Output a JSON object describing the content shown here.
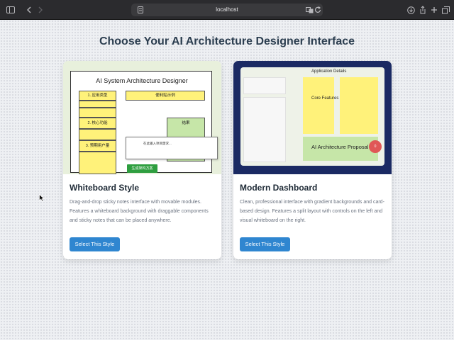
{
  "browser": {
    "url": "localhost"
  },
  "page": {
    "title": "Choose Your AI Architecture Designer Interface"
  },
  "cards": [
    {
      "title": "Whiteboard Style",
      "description": "Drag-and-drop sticky notes interface with movable modules. Features a whiteboard background with draggable components and sticky notes that can be placed anywhere.",
      "button": "Select This Style",
      "preview": {
        "heading": "AI System Architecture Designer",
        "stickies": [
          "1. 应用类型",
          "2. 核心功能",
          "3. 预期用户量"
        ],
        "example_note": "便利贴示例",
        "result_note": "结果",
        "input_placeholder": "在此输入项目需求...",
        "generate_button": "生成架构方案"
      }
    },
    {
      "title": "Modern Dashboard",
      "description": "Clean, professional interface with gradient backgrounds and card-based design. Features a split layout with controls on the left and visual whiteboard on the right.",
      "button": "Select This Style",
      "preview": {
        "app_details": "Application Details",
        "core_features": "Core Features",
        "proposal": "AI Architecture Proposal",
        "badge": "0"
      }
    }
  ],
  "colors": {
    "accent": "#2f86d0",
    "title": "#2c3e50",
    "sticky": "#fff27a",
    "dashboard_frame": "#1b2a63"
  }
}
